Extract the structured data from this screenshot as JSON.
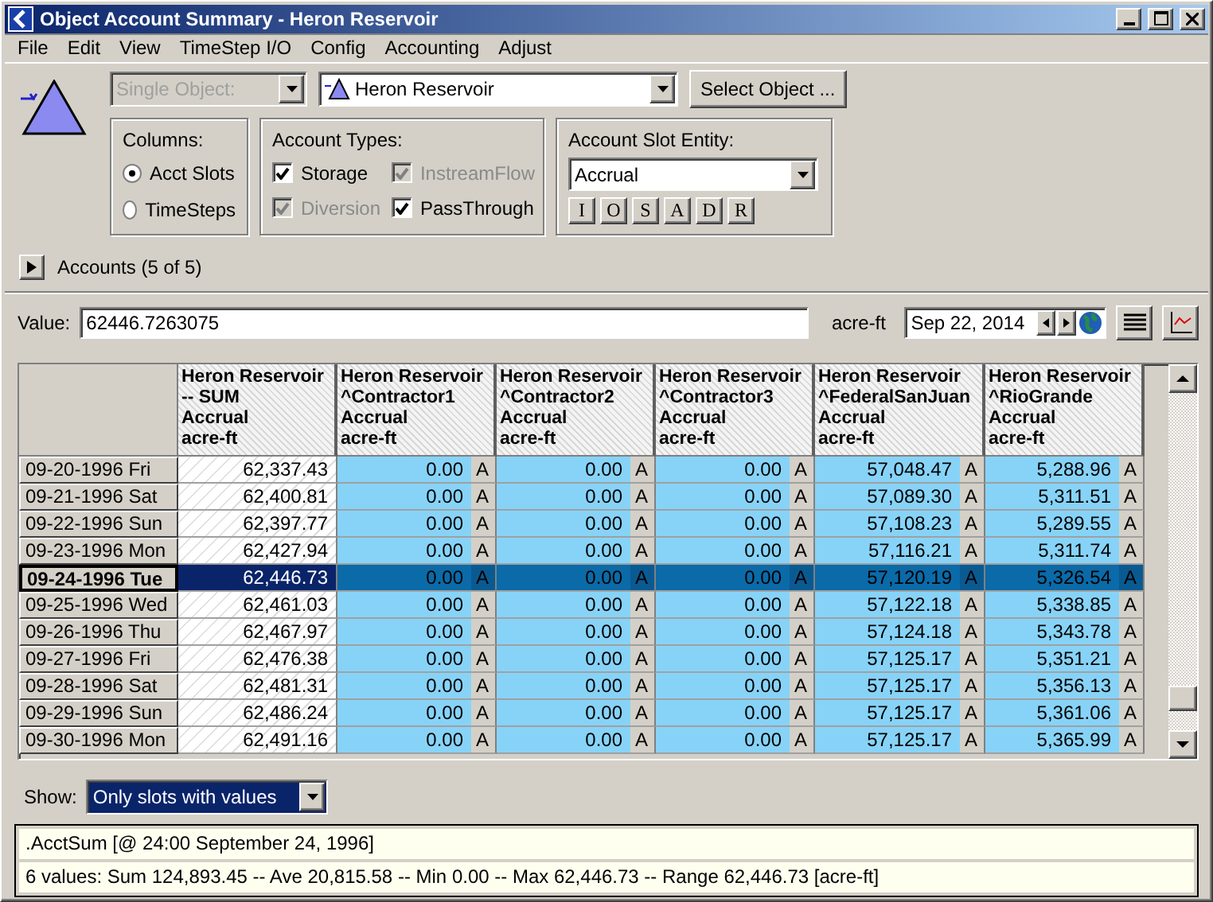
{
  "window": {
    "title": "Object Account Summary - Heron Reservoir"
  },
  "menu": [
    "File",
    "Edit",
    "View",
    "TimeStep I/O",
    "Config",
    "Accounting",
    "Adjust"
  ],
  "object_mode": {
    "value": "Single Object:",
    "disabled": true
  },
  "object": {
    "value": "Heron Reservoir"
  },
  "select_button": "Select Object ...",
  "columns_group": {
    "title": "Columns:",
    "options": [
      {
        "label": "Acct Slots",
        "selected": true
      },
      {
        "label": "TimeSteps",
        "selected": false
      }
    ]
  },
  "account_types": {
    "title": "Account Types:",
    "items": [
      {
        "label": "Storage",
        "checked": true,
        "disabled": false
      },
      {
        "label": "InstreamFlow",
        "checked": true,
        "disabled": true
      },
      {
        "label": "Diversion",
        "checked": true,
        "disabled": true
      },
      {
        "label": "PassThrough",
        "checked": true,
        "disabled": false
      }
    ]
  },
  "slot_entity": {
    "title": "Account Slot Entity:",
    "value": "Accrual",
    "buttons": [
      "I",
      "O",
      "S",
      "A",
      "D",
      "R"
    ]
  },
  "accounts": {
    "label": "Accounts (5 of 5)",
    "expanded": false
  },
  "value_row": {
    "label": "Value:",
    "value": "62446.7263075",
    "unit": "acre-ft",
    "date": "Sep 22, 2014"
  },
  "table": {
    "columns": [
      {
        "lines": [
          "Heron Reservoir",
          "-- SUM",
          "Accrual",
          "acre-ft"
        ],
        "kind": "sum"
      },
      {
        "lines": [
          "Heron Reservoir",
          "^Contractor1",
          "Accrual",
          "acre-ft"
        ],
        "kind": "account"
      },
      {
        "lines": [
          "Heron Reservoir",
          "^Contractor2",
          "Accrual",
          "acre-ft"
        ],
        "kind": "account"
      },
      {
        "lines": [
          "Heron Reservoir",
          "^Contractor3",
          "Accrual",
          "acre-ft"
        ],
        "kind": "account"
      },
      {
        "lines": [
          "Heron Reservoir",
          "^FederalSanJuan",
          "Accrual",
          "acre-ft"
        ],
        "kind": "account"
      },
      {
        "lines": [
          "Heron Reservoir",
          "^RioGrande",
          "Accrual",
          "acre-ft"
        ],
        "kind": "account"
      }
    ],
    "rows": [
      {
        "date": "09-20-1996 Fri",
        "selected": false,
        "values": [
          "62,337.43",
          "0.00",
          "0.00",
          "0.00",
          "57,048.47",
          "5,288.96"
        ],
        "flags": [
          "A",
          "A",
          "A",
          "A",
          "A"
        ]
      },
      {
        "date": "09-21-1996 Sat",
        "selected": false,
        "values": [
          "62,400.81",
          "0.00",
          "0.00",
          "0.00",
          "57,089.30",
          "5,311.51"
        ],
        "flags": [
          "A",
          "A",
          "A",
          "A",
          "A"
        ]
      },
      {
        "date": "09-22-1996 Sun",
        "selected": false,
        "values": [
          "62,397.77",
          "0.00",
          "0.00",
          "0.00",
          "57,108.23",
          "5,289.55"
        ],
        "flags": [
          "A",
          "A",
          "A",
          "A",
          "A"
        ]
      },
      {
        "date": "09-23-1996 Mon",
        "selected": false,
        "values": [
          "62,427.94",
          "0.00",
          "0.00",
          "0.00",
          "57,116.21",
          "5,311.74"
        ],
        "flags": [
          "A",
          "A",
          "A",
          "A",
          "A"
        ]
      },
      {
        "date": "09-24-1996 Tue",
        "selected": true,
        "values": [
          "62,446.73",
          "0.00",
          "0.00",
          "0.00",
          "57,120.19",
          "5,326.54"
        ],
        "flags": [
          "A",
          "A",
          "A",
          "A",
          "A"
        ]
      },
      {
        "date": "09-25-1996 Wed",
        "selected": false,
        "values": [
          "62,461.03",
          "0.00",
          "0.00",
          "0.00",
          "57,122.18",
          "5,338.85"
        ],
        "flags": [
          "A",
          "A",
          "A",
          "A",
          "A"
        ]
      },
      {
        "date": "09-26-1996 Thu",
        "selected": false,
        "values": [
          "62,467.97",
          "0.00",
          "0.00",
          "0.00",
          "57,124.18",
          "5,343.78"
        ],
        "flags": [
          "A",
          "A",
          "A",
          "A",
          "A"
        ]
      },
      {
        "date": "09-27-1996 Fri",
        "selected": false,
        "values": [
          "62,476.38",
          "0.00",
          "0.00",
          "0.00",
          "57,125.17",
          "5,351.21"
        ],
        "flags": [
          "A",
          "A",
          "A",
          "A",
          "A"
        ]
      },
      {
        "date": "09-28-1996 Sat",
        "selected": false,
        "values": [
          "62,481.31",
          "0.00",
          "0.00",
          "0.00",
          "57,125.17",
          "5,356.13"
        ],
        "flags": [
          "A",
          "A",
          "A",
          "A",
          "A"
        ]
      },
      {
        "date": "09-29-1996 Sun",
        "selected": false,
        "values": [
          "62,486.24",
          "0.00",
          "0.00",
          "0.00",
          "57,125.17",
          "5,361.06"
        ],
        "flags": [
          "A",
          "A",
          "A",
          "A",
          "A"
        ]
      },
      {
        "date": "09-30-1996 Mon",
        "selected": false,
        "values": [
          "62,491.16",
          "0.00",
          "0.00",
          "0.00",
          "57,125.17",
          "5,365.99"
        ],
        "flags": [
          "A",
          "A",
          "A",
          "A",
          "A"
        ]
      }
    ]
  },
  "show": {
    "label": "Show:",
    "value": "Only slots with values"
  },
  "status": [
    ".AcctSum [@ 24:00 September 24, 1996]",
    "6 values:  Sum 124,893.45 -- Ave 20,815.58 -- Min 0.00 -- Max 62,446.73 -- Range 62,446.73 [acre-ft]"
  ]
}
